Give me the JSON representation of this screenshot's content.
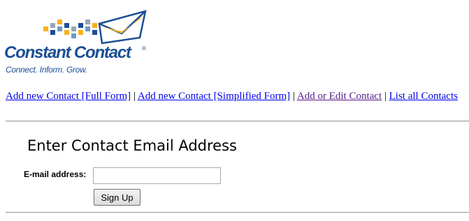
{
  "brand": {
    "name": "Constant Contact",
    "registered_mark": "®",
    "tagline": "Connect. Inform. Grow.",
    "logo_icon": "envelope-with-squares-icon",
    "colors": {
      "blue": "#1b4f95",
      "light_blue": "#6d9ac9",
      "gold": "#f5b21b",
      "gray": "#9aa5b1"
    }
  },
  "nav": {
    "items": [
      {
        "label": "Add new Contact [Full Form]",
        "visited": false
      },
      {
        "label": "Add new Contact [Simplified Form]",
        "visited": false
      },
      {
        "label": "Add or Edit Contact",
        "visited": true
      },
      {
        "label": "List all Contacts",
        "visited": false
      }
    ],
    "separator": "|",
    "link_color": "#0000ee",
    "visited_color": "#551a8b"
  },
  "form": {
    "title": "Enter Contact Email Address",
    "email_label": "E-mail address:",
    "email_value": "",
    "email_placeholder": "",
    "submit_label": "Sign Up"
  }
}
